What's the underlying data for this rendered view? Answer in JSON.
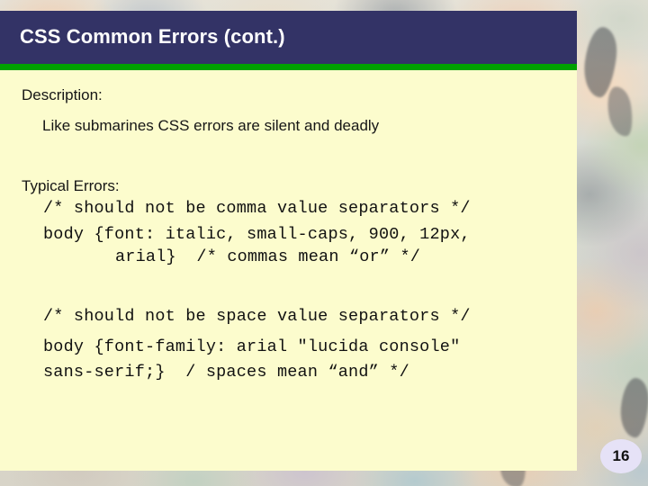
{
  "slide": {
    "title": "CSS Common Errors (cont.)",
    "page_number": "16",
    "description_label": "Description:",
    "description_text": "Like submarines CSS errors are silent and deadly",
    "typical_errors_label": "Typical Errors:",
    "code_block_1": [
      "/* should not be comma value separators */",
      "body {font: italic, small-caps, 900, 12px,",
      "arial}  /* commas mean “or” */"
    ],
    "code_block_2": [
      "/* should not be space value separators */",
      "body {font-family: arial \"lucida console\"",
      "sans-serif;}  / spaces mean “and” */"
    ]
  },
  "colors": {
    "title_band": "#333366",
    "title_rule": "#00a000",
    "content_panel": "#fcfccd",
    "title_text": "#ffffff",
    "body_text": "#161616",
    "page_number_bubble": "#e6e2f7"
  }
}
